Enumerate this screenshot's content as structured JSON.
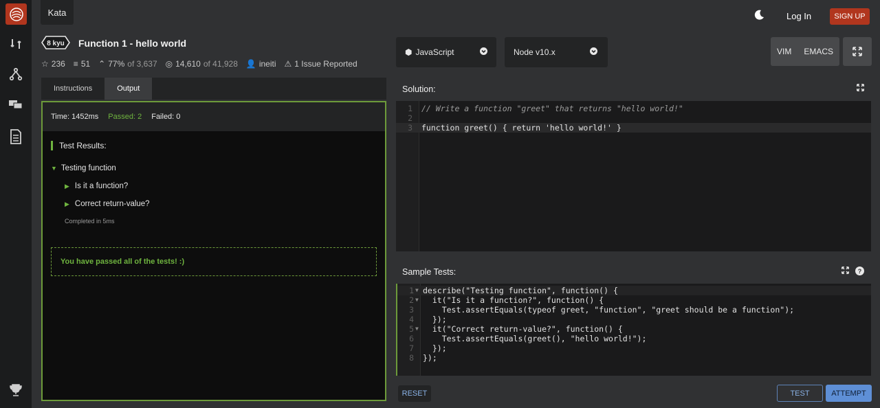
{
  "topbar": {
    "tab": "Kata",
    "login": "Log In",
    "signup": "SIGN UP"
  },
  "kata": {
    "rank": "8 kyu",
    "title": "Function 1 - hello world",
    "stars": "236",
    "collections": "51",
    "satisfaction": "77%",
    "satisfaction_of": "of 3,637",
    "completed": "14,610",
    "completed_of": "of 41,928",
    "author": "ineiti",
    "issues": "1 Issue Reported"
  },
  "tabs": [
    {
      "label": "Instructions"
    },
    {
      "label": "Output"
    }
  ],
  "output": {
    "time": "Time: 1452ms",
    "passed": "Passed: 2",
    "failed": "Failed: 0",
    "results_title": "Test Results:",
    "describe": "Testing function",
    "its": [
      "Is it a function?",
      "Correct return-value?"
    ],
    "completed": "Completed in 5ms",
    "pass_msg": "You have passed all of the tests! :)"
  },
  "language": {
    "selected": "JavaScript",
    "version": "Node v10.x"
  },
  "editor_modes": {
    "vim": "VIM",
    "emacs": "EMACS"
  },
  "solution": {
    "title": "Solution:",
    "lines": [
      "// Write a function \"greet\" that returns \"hello world!\"",
      "",
      "function greet() { return 'hello world!' }"
    ]
  },
  "sample_tests": {
    "title": "Sample Tests:",
    "lines": [
      "describe(\"Testing function\", function() {",
      "  it(\"Is it a function?\", function() {",
      "    Test.assertEquals(typeof greet, \"function\", \"greet should be a function\");",
      "  });",
      "  it(\"Correct return-value?\", function() {",
      "    Test.assertEquals(greet(), \"hello world!\");",
      "  });",
      "});"
    ]
  },
  "actions": {
    "reset": "RESET",
    "test": "TEST",
    "attempt": "ATTEMPT"
  },
  "colors": {
    "brand": "#b1361e",
    "passed": "#6fb43f",
    "attempt": "#5e8fd6"
  }
}
